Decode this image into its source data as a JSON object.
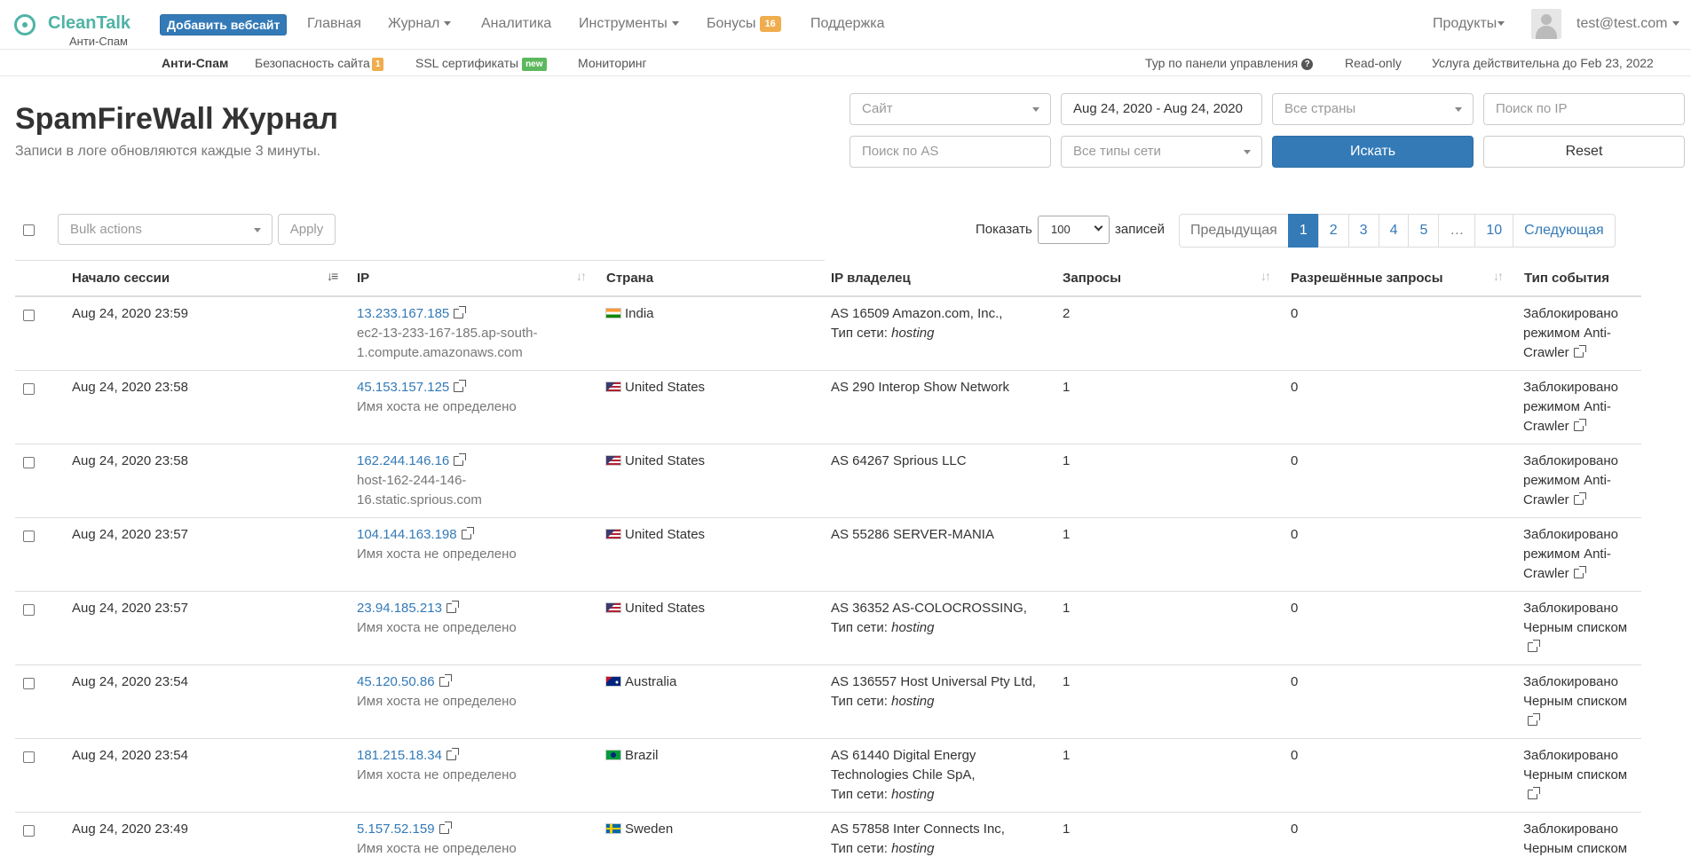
{
  "navbar": {
    "brand": "CleanTalk",
    "brand_sub": "Анти-Спам",
    "add_site": "Добавить вебсайт",
    "items": [
      "Главная",
      "Журнал",
      "Аналитика",
      "Инструменты",
      "Бонусы",
      "Поддержка"
    ],
    "bonus_count": "16",
    "products": "Продукты",
    "user": "test@test.com"
  },
  "subnav": {
    "antispam": "Анти-Спам",
    "security": "Безопасность сайта",
    "security_badge": "1",
    "ssl": "SSL сертификаты",
    "ssl_badge": "new",
    "monitoring": "Мониторинг",
    "tour": "Тур по панели управления",
    "readonly": "Read-only",
    "valid_until": "Услуга действительна до Feb 23, 2022"
  },
  "header": {
    "title": "SpamFireWall Журнал",
    "subtitle": "Записи в логе обновляются каждые 3 минуты."
  },
  "filters": {
    "site_placeholder": "Сайт",
    "date_range": "Aug 24, 2020 - Aug 24, 2020",
    "countries_placeholder": "Все страны",
    "ip_placeholder": "Поиск по IP",
    "as_placeholder": "Поиск по AS",
    "network_placeholder": "Все типы сети",
    "search_button": "Искать",
    "reset_button": "Reset"
  },
  "controls": {
    "bulk_placeholder": "Bulk actions",
    "apply": "Apply",
    "show": "Показать",
    "per_page": "100",
    "records": "записей"
  },
  "pagination": {
    "prev": "Предыдущая",
    "pages": [
      "1",
      "2",
      "3",
      "4",
      "5",
      "…",
      "10"
    ],
    "next": "Следующая",
    "current": "1"
  },
  "table": {
    "columns": [
      "Начало сессии",
      "IP",
      "Страна",
      "IP владелец",
      "Запросы",
      "Разрешённые запросы",
      "Тип события"
    ],
    "network_label": "Тип сети:",
    "rows": [
      {
        "time": "Aug 24, 2020 23:59",
        "ip": "13.233.167.185",
        "host1": "ec2-13-233-167-185.ap-south-",
        "host2": "1.compute.amazonaws.com",
        "flag": "in",
        "country": "India",
        "owner1": "AS 16509 Amazon.com, Inc.,",
        "owner2": "",
        "network": "hosting",
        "requests": "2",
        "allowed": "0",
        "event1": "Заблокировано",
        "event2": "режимом Anti-",
        "event3": "Crawler"
      },
      {
        "time": "Aug 24, 2020 23:58",
        "ip": "45.153.157.125",
        "host1": "Имя хоста не определено",
        "host2": "",
        "flag": "us",
        "country": "United States",
        "owner1": "AS 290 Interop Show Network",
        "owner2": "",
        "network": "",
        "requests": "1",
        "allowed": "0",
        "event1": "Заблокировано",
        "event2": "режимом Anti-",
        "event3": "Crawler"
      },
      {
        "time": "Aug 24, 2020 23:58",
        "ip": "162.244.146.16",
        "host1": "host-162-244-146-",
        "host2": "16.static.sprious.com",
        "flag": "us",
        "country": "United States",
        "owner1": "AS 64267 Sprious LLC",
        "owner2": "",
        "network": "",
        "requests": "1",
        "allowed": "0",
        "event1": "Заблокировано",
        "event2": "режимом Anti-",
        "event3": "Crawler"
      },
      {
        "time": "Aug 24, 2020 23:57",
        "ip": "104.144.163.198",
        "host1": "Имя хоста не определено",
        "host2": "",
        "flag": "us",
        "country": "United States",
        "owner1": "AS 55286 SERVER-MANIA",
        "owner2": "",
        "network": "",
        "requests": "1",
        "allowed": "0",
        "event1": "Заблокировано",
        "event2": "режимом Anti-",
        "event3": "Crawler"
      },
      {
        "time": "Aug 24, 2020 23:57",
        "ip": "23.94.185.213",
        "host1": "Имя хоста не определено",
        "host2": "",
        "flag": "us",
        "country": "United States",
        "owner1": "AS 36352 AS-COLOCROSSING,",
        "owner2": "",
        "network": "hosting",
        "requests": "1",
        "allowed": "0",
        "event1": "Заблокировано",
        "event2": "Черным списком",
        "event3": ""
      },
      {
        "time": "Aug 24, 2020 23:54",
        "ip": "45.120.50.86",
        "host1": "Имя хоста не определено",
        "host2": "",
        "flag": "au",
        "country": "Australia",
        "owner1": "AS 136557 Host Universal Pty Ltd,",
        "owner2": "",
        "network": "hosting",
        "requests": "1",
        "allowed": "0",
        "event1": "Заблокировано",
        "event2": "Черным списком",
        "event3": ""
      },
      {
        "time": "Aug 24, 2020 23:54",
        "ip": "181.215.18.34",
        "host1": "Имя хоста не определено",
        "host2": "",
        "flag": "br",
        "country": "Brazil",
        "owner1": "AS 61440 Digital Energy",
        "owner2": "Technologies Chile SpA,",
        "network": "hosting",
        "requests": "1",
        "allowed": "0",
        "event1": "Заблокировано",
        "event2": "Черным списком",
        "event3": ""
      },
      {
        "time": "Aug 24, 2020 23:49",
        "ip": "5.157.52.159",
        "host1": "Имя хоста не определено",
        "host2": "",
        "flag": "se",
        "country": "Sweden",
        "owner1": "AS 57858 Inter Connects Inc,",
        "owner2": "",
        "network": "hosting",
        "requests": "1",
        "allowed": "0",
        "event1": "Заблокировано",
        "event2": "Черным списком",
        "event3": ""
      }
    ]
  }
}
